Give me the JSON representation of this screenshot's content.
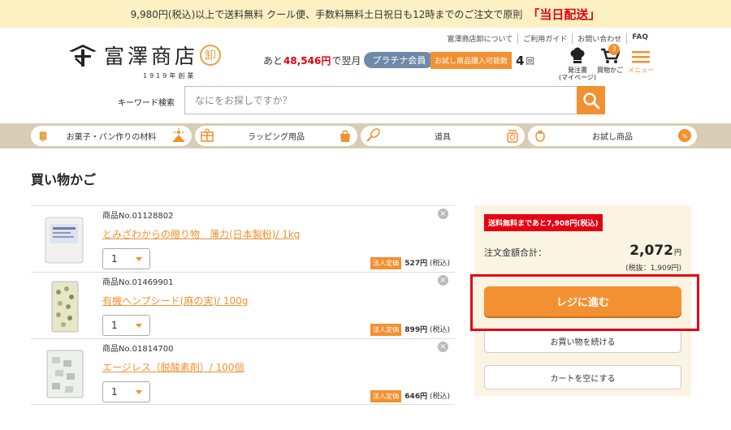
{
  "banner": {
    "text": "9,980円(税込)以上で送料無料 クール便、手数料無料土日祝日も12時までのご注文で原則",
    "highlight": "「当日配送」"
  },
  "header": {
    "links": [
      "富澤商店卸について",
      "ご利用ガイド",
      "お問い合わせ",
      "FAQ"
    ],
    "logo": {
      "text": "富澤商店",
      "seal": "卸",
      "sub": "1919年創業"
    },
    "points": {
      "prefix": "あと",
      "amount": "48,546円",
      "suffix": "で翌月",
      "rank": "プラチナ会員"
    },
    "trial": {
      "label": "お試し商品購入可能数",
      "count": "4",
      "unit": "回"
    },
    "icons": {
      "order_label": "発注書\n(マイページ)",
      "cart_label": "買物かご",
      "cart_count": "3",
      "menu_label": "メニュー"
    }
  },
  "search": {
    "label": "キーワード検索",
    "placeholder": "なにをお探しですか？"
  },
  "categories": [
    "お菓子・パン作りの材料",
    "ラッピング用品",
    "道具",
    "お試し商品"
  ],
  "page_title": "買い物かご",
  "cart_items": [
    {
      "no": "商品No.01128802",
      "name": "とみざわからの贈り物　薄力(日本製粉)/ 1kg",
      "qty": "1",
      "tag": "法人定価",
      "price": "527円",
      "tax": "(税込)"
    },
    {
      "no": "商品No.01469901",
      "name": "有機ヘンプシード(麻の実)/ 100g",
      "qty": "1",
      "tag": "法人定価",
      "price": "899円",
      "tax": "(税込)"
    },
    {
      "no": "商品No.01814700",
      "name": "エージレス（脱酸素剤）/ 100個",
      "qty": "1",
      "tag": "法人定価",
      "price": "646円",
      "tax": "(税込)"
    }
  ],
  "summary": {
    "free_shipping": "送料無料まであと7,908円(税込)",
    "total_label": "注文金額合計：",
    "total_value": "2,072",
    "total_unit": "円",
    "tax_note": "(税抜：1,909円)",
    "checkout": "レジに進む",
    "continue": "お買い物を続ける",
    "empty": "カートを空にする"
  },
  "colors": {
    "accent": "#f39031",
    "alert": "#e60012",
    "banner_bg": "#fdf0c2",
    "catbar_bg": "#d8ccb4",
    "summary_bg": "#fcf4e2"
  }
}
